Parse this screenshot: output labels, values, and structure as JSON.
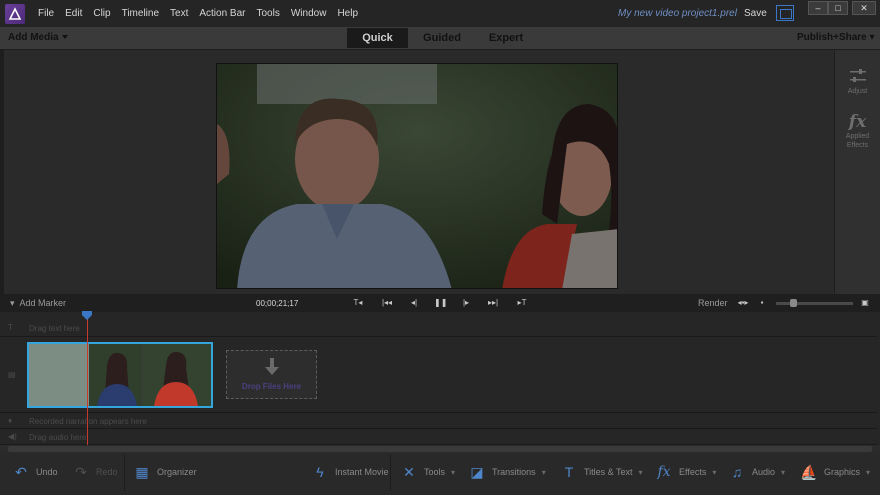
{
  "app": {
    "menu": [
      "File",
      "Edit",
      "Clip",
      "Timeline",
      "Text",
      "Action Bar",
      "Tools",
      "Window",
      "Help"
    ],
    "project_title": "My new video project1.prel",
    "save_label": "Save",
    "window_buttons": {
      "minimize": "‒",
      "maximize": "□",
      "close": "✕"
    }
  },
  "modebar": {
    "add_media": "Add Media",
    "tabs": [
      "Quick",
      "Guided",
      "Expert"
    ],
    "active_tab": "Quick",
    "publish": "Publish+Share"
  },
  "right_panel": {
    "adjust": "Adjust",
    "applied_effects_line1": "Applied",
    "applied_effects_line2": "Effects"
  },
  "timeline": {
    "add_marker": "Add Marker",
    "timecode": "00;00;21;17",
    "render": "Render",
    "tracks": {
      "text_hint": "Drag text here",
      "narration_hint": "Recorded narration appears here",
      "audio_hint": "Drag audio here"
    },
    "drop_zone": "Drop Files Here"
  },
  "actionbar": {
    "undo": "Undo",
    "redo": "Redo",
    "organizer": "Organizer",
    "instant_movie": "Instant Movie",
    "tools": "Tools",
    "transitions": "Transitions",
    "titles_text": "Titles & Text",
    "effects": "Effects",
    "audio": "Audio",
    "graphics": "Graphics"
  },
  "colors": {
    "accent_blue": "#35a5dd",
    "playhead_red": "#c7382f",
    "project_title_blue": "#6f8fc4",
    "logo_purple": "#6a3f9a"
  }
}
